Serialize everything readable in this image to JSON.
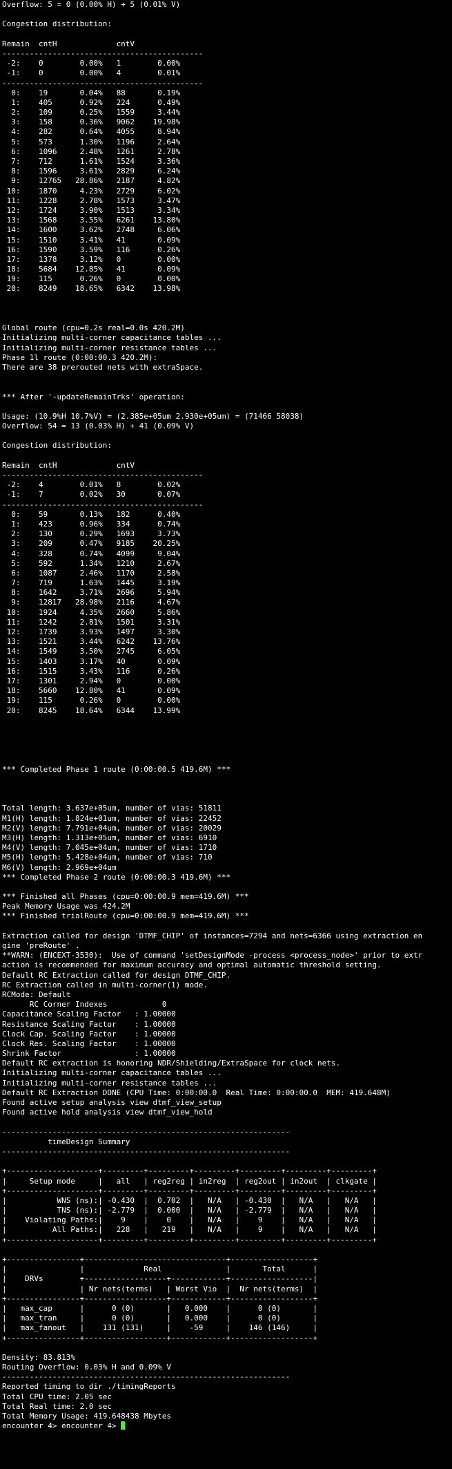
{
  "terminal": {
    "cursor_color": "#4ee94e",
    "lines": [
      "Overflow: 5 = 0 (0.00% H) + 5 (0.01% V)",
      "",
      "Congestion distribution:",
      "",
      "Remain  cntH             cntV",
      "--------------------------------------------",
      " -2:    0        0.00%   1        0.00%",
      " -1:    0        0.00%   4        0.01%",
      "--------------------------------------------",
      "  0:    19       0.04%   88       0.19%",
      "  1:    405      0.92%   224      0.49%",
      "  2:    109      0.25%   1559     3.44%",
      "  3:    158      0.36%   9062    19.98%",
      "  4:    282      0.64%   4055     8.94%",
      "  5:    573      1.30%   1196     2.64%",
      "  6:    1096     2.48%   1261     2.78%",
      "  7:    712      1.61%   1524     3.36%",
      "  8:    1596     3.61%   2829     6.24%",
      "  9:    12765   28.86%   2187     4.82%",
      " 10:    1870     4.23%   2729     6.02%",
      " 11:    1228     2.78%   1573     3.47%",
      " 12:    1724     3.90%   1513     3.34%",
      " 13:    1568     3.55%   6261    13.80%",
      " 14:    1600     3.62%   2748     6.06%",
      " 15:    1510     3.41%   41       0.09%",
      " 16:    1590     3.59%   116      0.26%",
      " 17:    1378     3.12%   0        0.00%",
      " 18:    5684    12.85%   41       0.09%",
      " 19:    115      0.26%   0        0.00%",
      " 20:    8249    18.65%   6342    13.98%",
      "",
      "",
      "",
      "Global route (cpu=0.2s real=0.0s 420.2M)",
      "Initializing multi-corner capacitance tables ...",
      "Initializing multi-corner resistance tables ...",
      "Phase 1l route (0:00:00.3 420.2M):",
      "There are 38 prerouted nets with extraSpace.",
      "",
      "",
      "*** After '-updateRemainTrks' operation:",
      "",
      "Usage: (10.9%H 10.7%V) = (2.385e+05um 2.930e+05um) = (71466 58038)",
      "Overflow: 54 = 13 (0.03% H) + 41 (0.09% V)",
      "",
      "Congestion distribution:",
      "",
      "Remain  cntH             cntV",
      "--------------------------------------------",
      " -2:    4        0.01%   8        0.02%",
      " -1:    7        0.02%   30       0.07%",
      "--------------------------------------------",
      "  0:    59       0.13%   182      0.40%",
      "  1:    423      0.96%   334      0.74%",
      "  2:    130      0.29%   1693     3.73%",
      "  3:    209      0.47%   9185    20.25%",
      "  4:    328      0.74%   4099     9.04%",
      "  5:    592      1.34%   1210     2.67%",
      "  6:    1087     2.46%   1170     2.58%",
      "  7:    719      1.63%   1445     3.19%",
      "  8:    1642     3.71%   2696     5.94%",
      "  9:    12817   28.98%   2116     4.67%",
      " 10:    1924     4.35%   2660     5.86%",
      " 11:    1242     2.81%   1501     3.31%",
      " 12:    1739     3.93%   1497     3.30%",
      " 13:    1521     3.44%   6242    13.76%",
      " 14:    1549     3.50%   2745     6.05%",
      " 15:    1403     3.17%   40       0.09%",
      " 16:    1515     3.43%   116      0.26%",
      " 17:    1301     2.94%   0        0.00%",
      " 18:    5660    12.80%   41       0.09%",
      " 19:    115      0.26%   0        0.00%",
      " 20:    8245    18.64%   6344    13.99%",
      "",
      "",
      "",
      "",
      "",
      "*** Completed Phase 1 route (0:00:00.5 419.6M) ***",
      "",
      "",
      "",
      "Total length: 3.637e+05um, number of vias: 51811",
      "M1(H) length: 1.824e+01um, number of vias: 22452",
      "M2(V) length: 7.791e+04um, number of vias: 20029",
      "M3(H) length: 1.313e+05um, number of vias: 6910",
      "M4(V) length: 7.045e+04um, number of vias: 1710",
      "M5(H) length: 5.428e+04um, number of vias: 710",
      "M6(V) length: 2.969e+04um",
      "*** Completed Phase 2 route (0:00:00.3 419.6M) ***",
      "",
      "*** Finished all Phases (cpu=0:00:00.9 mem=419.6M) ***",
      "Peak Memory Usage was 424.2M",
      "*** Finished trialRoute (cpu=0:00:00.9 mem=419.6M) ***",
      "",
      "Extraction called for design 'DTMF_CHIP' of instances=7294 and nets=6366 using extraction en",
      "gine 'preRoute' .",
      "**WARN: (ENCEXT-3530):  Use of command 'setDesignMode -process <process_node>' prior to extr",
      "action is recommended for maximum accuracy and optimal automatic threshold setting.",
      "Default RC Extraction called for design DTMF_CHIP.",
      "RC Extraction called in multi-corner(1) mode.",
      "RCMode: Default",
      "      RC Corner Indexes            0",
      "Capacitance Scaling Factor   : 1.00000",
      "Resistance Scaling Factor    : 1.00000",
      "Clock Cap. Scaling Factor    : 1.00000",
      "Clock Res. Scaling Factor    : 1.00000",
      "Shrink Factor                : 1.00000",
      "Default RC extraction is honoring NDR/Shielding/ExtraSpace for clock nets.",
      "Initializing multi-corner capacitance tables ...",
      "Initializing multi-corner resistance tables ...",
      "Default RC Extraction DONE (CPU Time: 0:00:00.0  Real Time: 0:00:00.0  MEM: 419.648M)",
      "Found active setup analysis view dtmf_view_setup",
      "Found active hold analysis view dtmf_view_hold",
      "",
      "---------------------------------------------------------------",
      "          timeDesign Summary",
      "---------------------------------------------------------------",
      "",
      "+--------------------+---------+---------+---------+---------+---------+---------+",
      "|     Setup mode     |   all   | reg2reg | in2reg  | reg2out | in2out  | clkgate |",
      "+--------------------+---------+---------+---------+---------+---------+---------+",
      "|           WNS (ns):| -0.430  |  0.702  |   N/A   | -0.430  |   N/A   |   N/A   |",
      "|           TNS (ns):| -2.779  |  0.000  |   N/A   | -2.779  |   N/A   |   N/A   |",
      "|    Violating Paths:|    9    |    0    |   N/A   |    9    |   N/A   |   N/A   |",
      "|          All Paths:|   228   |   219   |   N/A   |    9    |   N/A   |   N/A   |",
      "+--------------------+---------+---------+---------+---------+---------+---------+",
      "",
      "+----------------+-------------------------------+------------------+",
      "|                |             Real              |       Total      |",
      "|    DRVs        +------------------+------------+------------------|",
      "|                | Nr nets(terms)   | Worst Vio  |  Nr nets(terms)  |",
      "+----------------+------------------+------------+------------------+",
      "|   max_cap      |      0 (0)       |   0.000    |      0 (0)       |",
      "|   max_tran     |      0 (0)       |   0.000    |      0 (0)       |",
      "|   max_fanout   |    131 (131)     |    -59     |    146 (146)     |",
      "+----------------+------------------+------------+------------------+",
      "",
      "Density: 83.813%",
      "Routing Overflow: 0.03% H and 0.09% V",
      "---------------------------------------------------------------",
      "Reported timing to dir ./timingReports",
      "Total CPU time: 2.05 sec",
      "Total Real time: 2.0 sec",
      "Total Memory Usage: 419.648438 Mbytes"
    ],
    "prompt": "encounter 4> encounter 4> "
  }
}
